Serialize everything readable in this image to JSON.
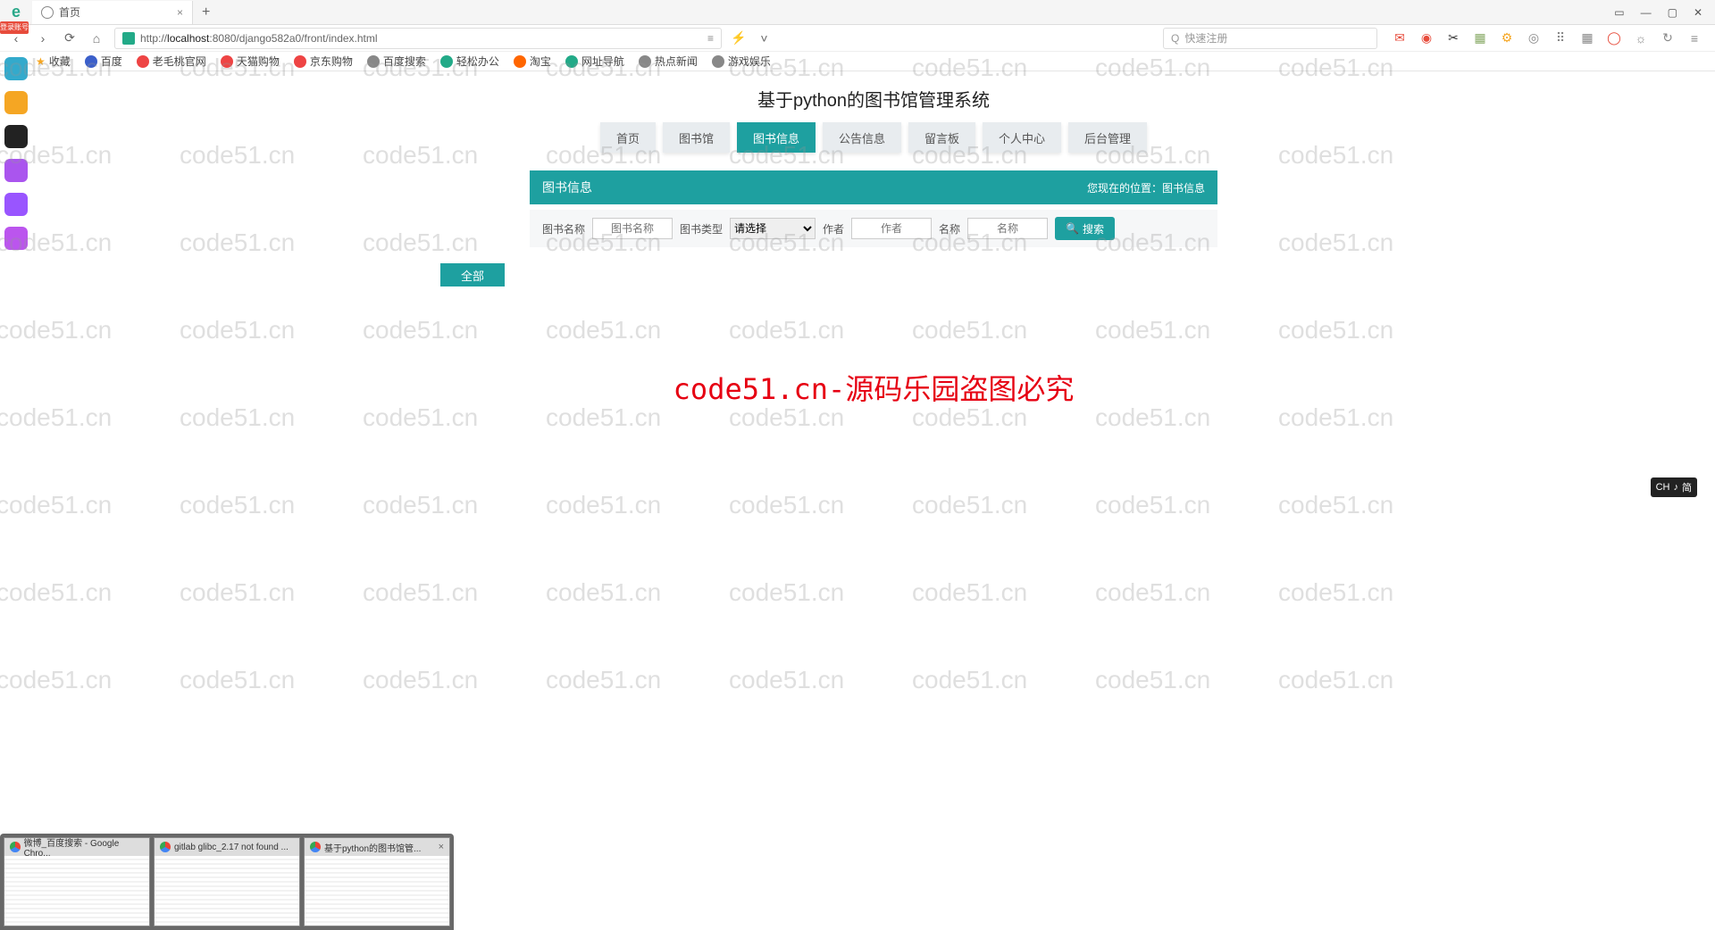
{
  "browser": {
    "logo_text": "e",
    "login_badge": "登录账号",
    "tab": {
      "title": "首页",
      "close": "×"
    },
    "new_tab": "+",
    "window_controls": {
      "menu": "▭",
      "min": "—",
      "max": "▢",
      "close": "✕"
    }
  },
  "address_bar": {
    "back": "‹",
    "forward": "›",
    "reload": "⟳",
    "home": "⌂",
    "url_prefix": "http://",
    "url_host": "localhost",
    "url_rest": ":8080/django582a0/front/index.html",
    "reader": "≡",
    "flash": "⚡",
    "dropdown": "˅",
    "search_icon": "Q",
    "search_placeholder": "快速注册",
    "toolbar_icons": [
      "✉",
      "◉",
      "✂",
      "▦",
      "⚙",
      "◎",
      "⠿",
      "▦",
      "◯",
      "☼",
      "↻",
      "≡"
    ]
  },
  "bookmarks": {
    "fav_label": "收藏",
    "items": [
      {
        "label": "百度",
        "color": "#3b5fca"
      },
      {
        "label": "老毛桃官网",
        "color": "#e44"
      },
      {
        "label": "天猫购物",
        "color": "#e44"
      },
      {
        "label": "京东购物",
        "color": "#e44"
      },
      {
        "label": "百度搜索",
        "color": "#888"
      },
      {
        "label": "轻松办公",
        "color": "#2a8"
      },
      {
        "label": "淘宝",
        "color": "#f60"
      },
      {
        "label": "网址导航",
        "color": "#2a8"
      },
      {
        "label": "热点新闻",
        "color": "#888"
      },
      {
        "label": "游戏娱乐",
        "color": "#888"
      }
    ]
  },
  "sidebar_colors": [
    "#3ac",
    "#f5a623",
    "#222",
    "#a5e",
    "#95f",
    "#b5e"
  ],
  "page": {
    "title": "基于python的图书馆管理系统",
    "tabs": [
      "首页",
      "图书馆",
      "图书信息",
      "公告信息",
      "留言板",
      "个人中心",
      "后台管理"
    ],
    "active_tab": "图书信息",
    "panel_title": "图书信息",
    "breadcrumb_prefix": "您现在的位置：",
    "breadcrumb_current": "图书信息",
    "search": {
      "name_label": "图书名称",
      "name_ph": "图书名称",
      "type_label": "图书类型",
      "type_option": "请选择",
      "author_label": "作者",
      "author_ph": "作者",
      "title_label": "名称",
      "title_ph": "名称",
      "button": "搜索"
    },
    "filter_button": "全部",
    "center_text": "code51.cn-源码乐园盗图必究"
  },
  "watermark_text": "code51.cn",
  "ime": {
    "lang": "CH",
    "mode": "♪",
    "ime": "简"
  },
  "taskbar": {
    "previews": [
      {
        "title": "微博_百度搜索 - Google Chro..."
      },
      {
        "title": "gitlab glibc_2.17 not found ..."
      },
      {
        "title": "基于python的图书馆管...",
        "close": "×"
      }
    ]
  }
}
